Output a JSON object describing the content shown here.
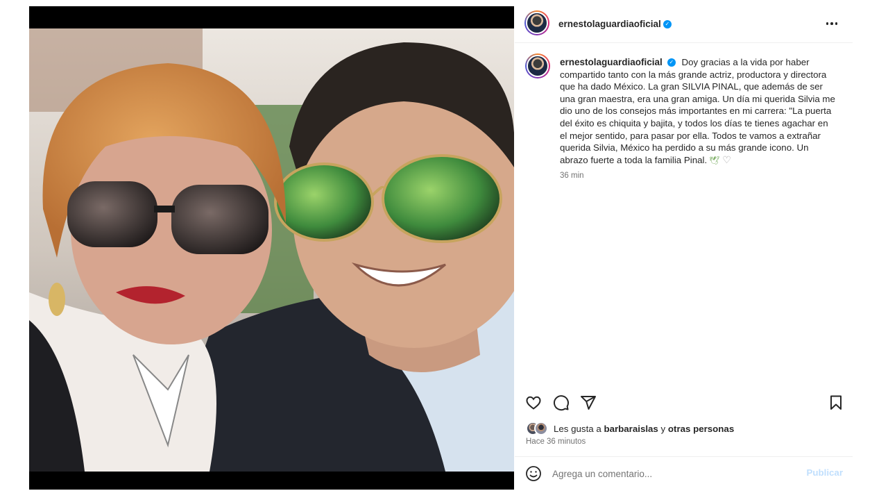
{
  "post": {
    "username": "ernestolaguardiaoficial",
    "verified": true,
    "caption": "Doy gracias a la vida por haber compartido tanto con la más grande actriz, productora y directora que ha dado México. La gran SILVIA PINAL, que además de ser una gran maestra, era una gran amiga. Un día mi querida Silvia me dio uno de los consejos más importantes en mi carrera: \"La puerta del éxito es chiquita y bajita, y todos los días te tienes agachar en el mejor sentido, para pasar por ella. Todos te vamos a extrañar querida Silvia, México ha perdido a su más grande icono. Un abrazo fuerte a toda la familia Pinal.",
    "caption_time": "36 min",
    "likes_prefix": "Les gusta a",
    "likes_user": "barbaraislas",
    "likes_mid": "y",
    "likes_suffix": "otras personas",
    "posted_ago": "Hace 36 minutos"
  },
  "icons": {
    "more": "more-options-icon",
    "like": "heart-icon",
    "comment": "comment-icon",
    "share": "send-icon",
    "save": "bookmark-icon",
    "emoji": "emoji-icon",
    "verified": "verified-badge-icon"
  },
  "comment": {
    "placeholder": "Agrega un comentario...",
    "publish_label": "Publicar"
  },
  "colors": {
    "accent": "#0095f6",
    "publish_disabled": "#c0dffd",
    "text_secondary": "#737373"
  }
}
